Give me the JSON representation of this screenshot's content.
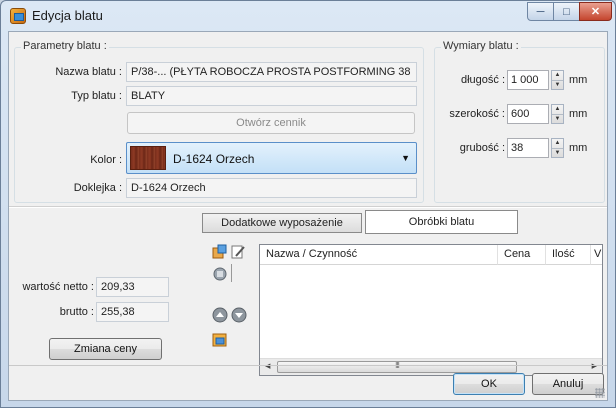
{
  "window": {
    "title": "Edycja blatu",
    "controls": {
      "minimize": "minimize-icon",
      "maximize": "maximize-icon",
      "close": "close-icon"
    }
  },
  "params": {
    "group_title": "Parametry blatu :",
    "name_label": "Nazwa blatu :",
    "name_value": "P/38-... (PŁYTA ROBOCZA PROSTA POSTFORMING 38",
    "type_label": "Typ blatu :",
    "type_value": "BLATY",
    "price_list_button": "Otwórz cennik",
    "color_label": "Kolor :",
    "color_value": "D-1624 Orzech",
    "edge_label": "Doklejka :",
    "edge_value": "D-1624 Orzech"
  },
  "dimensions": {
    "group_title": "Wymiary blatu :",
    "length_label": "długość :",
    "length_value": "1 000",
    "width_label": "szerokość :",
    "width_value": "600",
    "thickness_label": "grubość :",
    "thickness_value": "38",
    "unit": "mm"
  },
  "tabs": {
    "extra": "Dodatkowe wyposażenie",
    "processing": "Obróbki blatu",
    "active": "processing"
  },
  "price": {
    "net_label": "wartość netto :",
    "net_value": "209,33",
    "gross_label": "brutto :",
    "gross_value": "255,38",
    "change_button": "Zmiana ceny"
  },
  "table": {
    "columns": [
      "Nazwa / Czynność",
      "Cena",
      "Ilość",
      "V"
    ],
    "rows": [],
    "scroll_thumb": "III"
  },
  "footer": {
    "ok": "OK",
    "cancel": "Anuluj"
  },
  "colors": {
    "title_bar": "#c7d7ea",
    "close_button": "#c4452e",
    "combo_highlight": "#c3e0f7",
    "swatch_wood": "#7a2e1c"
  }
}
